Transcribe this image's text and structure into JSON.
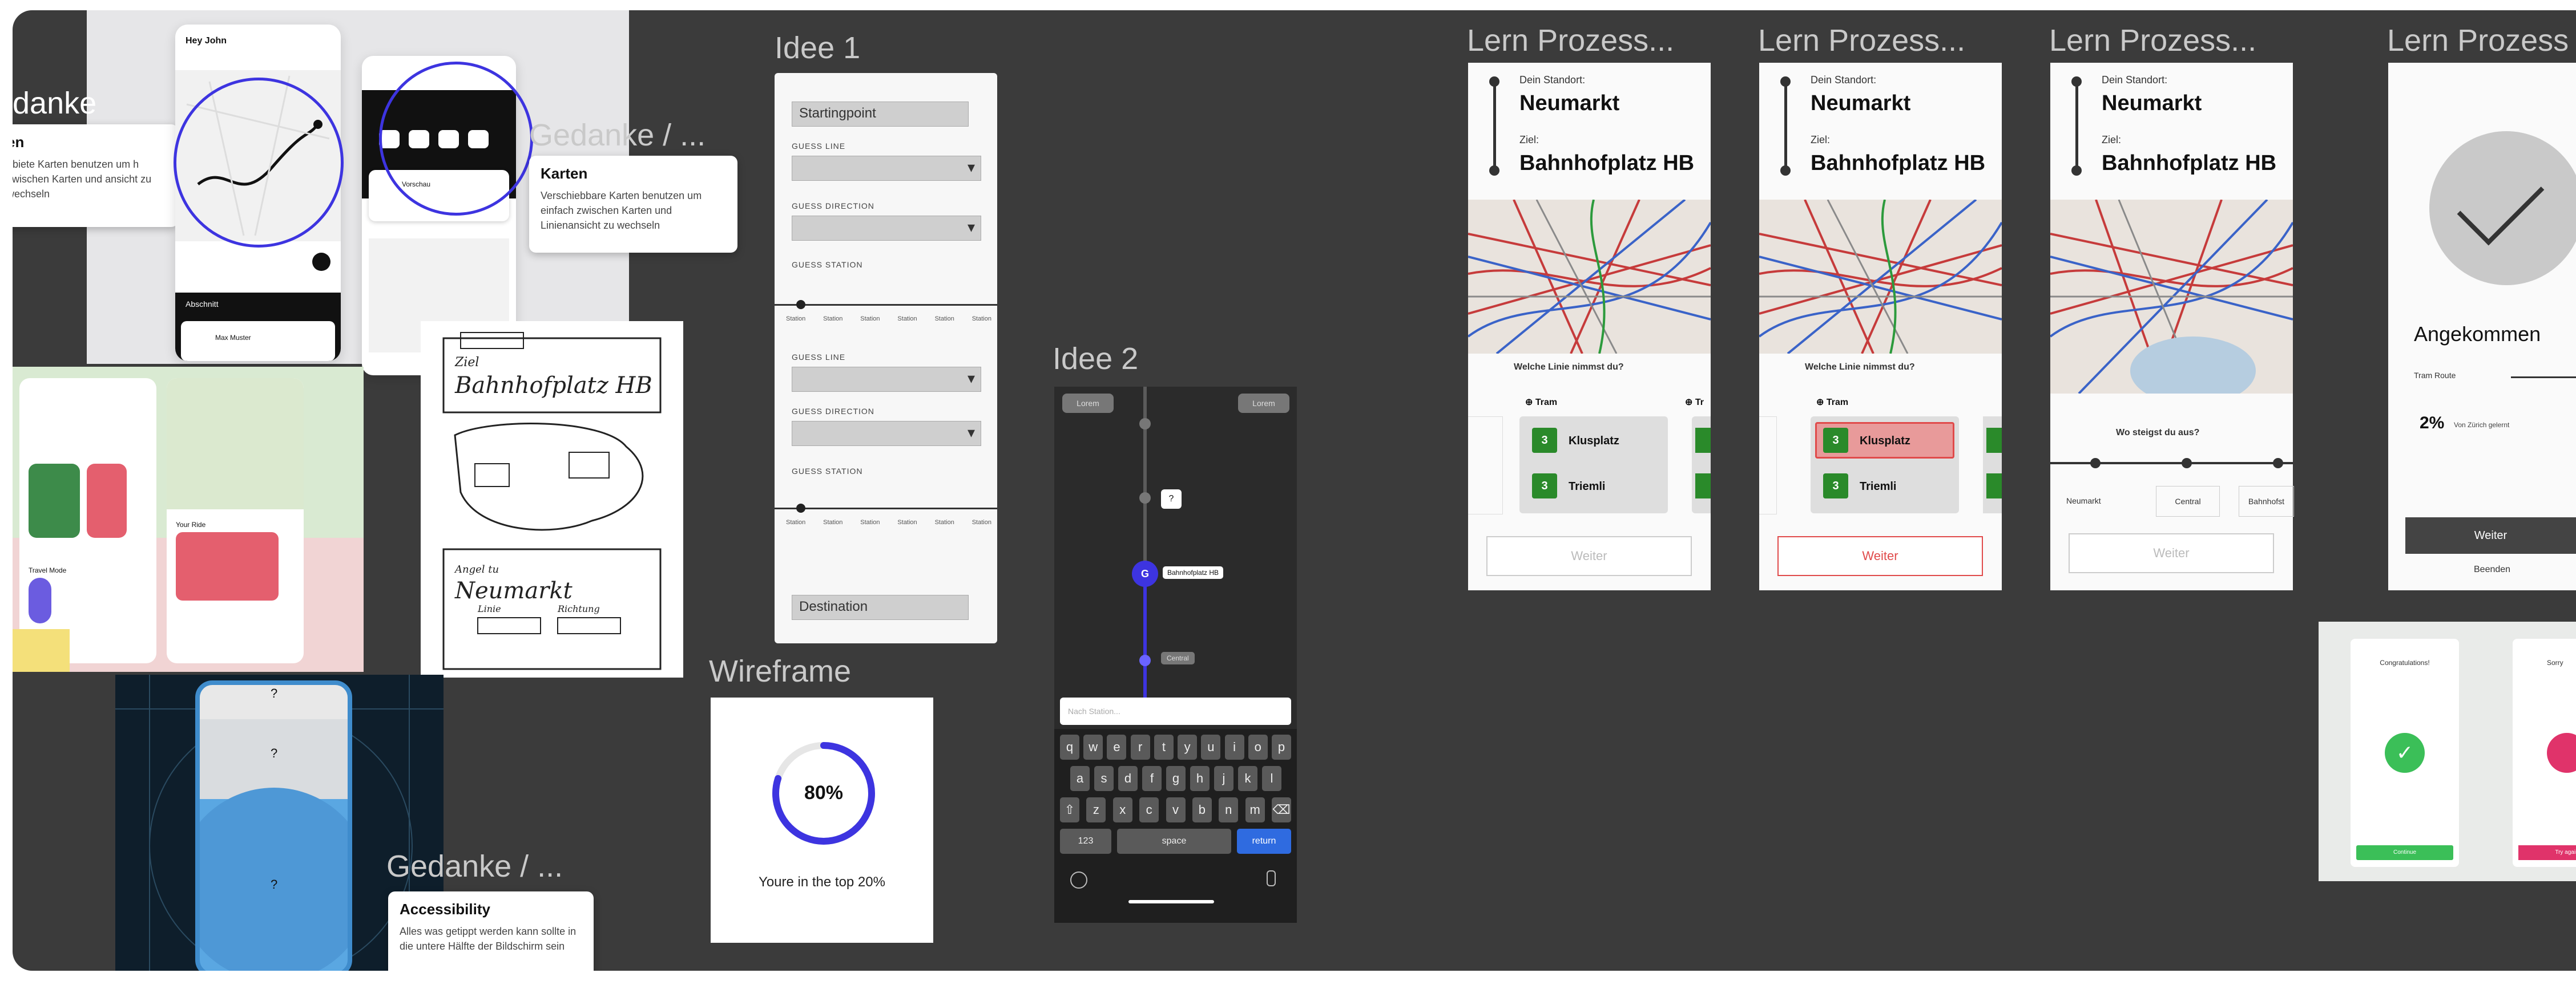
{
  "colors": {
    "canvas": "#3b3b3b",
    "accent_blue": "#3d34e0",
    "accent_red": "#e04a4a",
    "line_green": "#2a8a2a",
    "wire_gray": "#cfcfcf"
  },
  "frames": {
    "gedanke_left": {
      "title": "danke",
      "note_title": "en",
      "note_text": "ebiete Karten benutzen um h zwischen Karten und ansicht zu wechseln"
    },
    "gedanke_karten": {
      "title": "Gedanke / ...",
      "note_title": "Karten",
      "note_text": "Verschiebbare Karten benutzen um einfach zwischen Karten und Linienansicht zu wechseln"
    },
    "gedanke_access": {
      "title": "Gedanke / ...",
      "note_title": "Accessibility",
      "note_text": "Alles was getippt werden kann sollte in die untere Hälfte der Bildschirm sein"
    },
    "sketch": {
      "ziel_label": "Ziel",
      "ziel_value": "Bahnhofplatz HB",
      "start_label": "Angel tu",
      "start_value": "Neumarkt",
      "line_label": "Linie",
      "richtung_label": "Richtung"
    },
    "blue_phone": {
      "marks": [
        "?",
        "?",
        "?"
      ]
    },
    "idee1": {
      "title": "Idee 1",
      "starting_point": "Startingpoint",
      "guess_line": "GUESS LINE",
      "guess_direction": "GUESS DIRECTION",
      "guess_stations": "GUESS STATION",
      "stations": [
        "Station",
        "Station",
        "Station",
        "Station",
        "Station",
        "Station"
      ],
      "destination": "Destination"
    },
    "wireframe": {
      "title": "Wireframe",
      "percent": "80%",
      "progress": 0.8,
      "caption": "Youre in the top 20%"
    },
    "idee2": {
      "title": "Idee 2",
      "left_chip": "Lorem",
      "right_chip": "Lorem",
      "step_chip": "?",
      "current_label": "Bahnhofplatz HB",
      "next_chip": "Central",
      "marker": "G",
      "search_placeholder": "Nach Station...",
      "keys_row1": [
        "q",
        "w",
        "e",
        "r",
        "t",
        "y",
        "u",
        "i",
        "o",
        "p"
      ],
      "keys_row2": [
        "a",
        "s",
        "d",
        "f",
        "g",
        "h",
        "j",
        "k",
        "l"
      ],
      "keys_row3": [
        "z",
        "x",
        "c",
        "v",
        "b",
        "n",
        "m"
      ],
      "key_123": "123",
      "key_space": "space",
      "key_return": "return"
    },
    "lern1": {
      "title": "Lern Prozess...",
      "standort_label": "Dein Standort:",
      "standort": "Neumarkt",
      "ziel_label": "Ziel:",
      "ziel": "Bahnhofplatz HB",
      "question": "Welche Linie nimmst du?",
      "tram_label": "Tram",
      "tram_label_2": "Tr",
      "line_num": "3",
      "stop1": "Klusplatz",
      "stop2": "Triemli",
      "button": "Weiter"
    },
    "lern2": {
      "title": "Lern Prozess...",
      "standort_label": "Dein Standort:",
      "standort": "Neumarkt",
      "ziel_label": "Ziel:",
      "ziel": "Bahnhofplatz HB",
      "question": "Welche Linie nimmst du?",
      "tram_label": "Tram",
      "line_num": "3",
      "stop1": "Klusplatz",
      "stop2": "Triemli",
      "button": "Weiter"
    },
    "lern3": {
      "title": "Lern Prozess...",
      "standort_label": "Dein Standort:",
      "standort": "Neumarkt",
      "ziel_label": "Ziel:",
      "ziel": "Bahnhofplatz HB",
      "question": "Wo steigst du aus?",
      "stop_a": "Neumarkt",
      "stop_b": "Central",
      "stop_c": "Bahnhofst",
      "button": "Weiter"
    },
    "lern4": {
      "title": "Lern Prozess",
      "arrived": "Angekommen",
      "route_small": "Tram Route",
      "percent": "2%",
      "percent_caption": "Von Zürich gelernt",
      "button": "Weiter",
      "link": "Beenden"
    },
    "congrats": {
      "left_title": "Congratulations!",
      "right_title": "Sorry",
      "left_button": "Continue",
      "right_button": "Try again"
    },
    "screenshots": {
      "phone_greeting": "Hey John",
      "card_title": "Vorschau",
      "sheet_title": "Abschnitt",
      "user_name": "Max Muster",
      "travel_mode": "Travel Mode",
      "your_ride": "Your Ride"
    }
  }
}
